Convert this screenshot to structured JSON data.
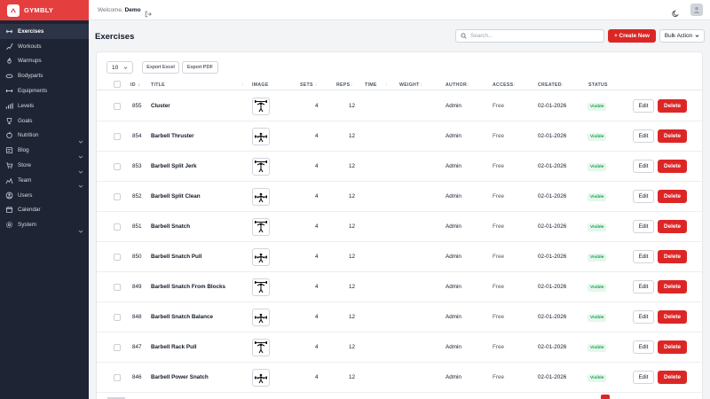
{
  "brand": {
    "name": "GYMBLY"
  },
  "topbar": {
    "welcome_prefix": "Welcome,",
    "user_name": "Demo"
  },
  "sidebar": {
    "items": [
      {
        "label": "Exercises",
        "icon": "dumbbell-icon",
        "active": true,
        "expandable": false
      },
      {
        "label": "Workouts",
        "icon": "workout-icon",
        "active": false,
        "expandable": false
      },
      {
        "label": "Warmups",
        "icon": "warmup-icon",
        "active": false,
        "expandable": false
      },
      {
        "label": "Bodyparts",
        "icon": "bodypart-icon",
        "active": false,
        "expandable": false
      },
      {
        "label": "Equipments",
        "icon": "equipment-icon",
        "active": false,
        "expandable": false
      },
      {
        "label": "Levels",
        "icon": "levels-icon",
        "active": false,
        "expandable": false
      },
      {
        "label": "Goals",
        "icon": "goals-icon",
        "active": false,
        "expandable": false
      },
      {
        "label": "Nutrition",
        "icon": "nutrition-icon",
        "active": false,
        "expandable": true
      },
      {
        "label": "Blog",
        "icon": "blog-icon",
        "active": false,
        "expandable": true
      },
      {
        "label": "Store",
        "icon": "store-icon",
        "active": false,
        "expandable": true
      },
      {
        "label": "Team",
        "icon": "team-icon",
        "active": false,
        "expandable": true
      },
      {
        "label": "Users",
        "icon": "users-icon",
        "active": false,
        "expandable": false
      },
      {
        "label": "Calendar",
        "icon": "calendar-icon",
        "active": false,
        "expandable": false
      },
      {
        "label": "System",
        "icon": "gear-icon",
        "active": false,
        "expandable": true
      }
    ]
  },
  "header": {
    "title": "Exercises",
    "search_placeholder": "Search...",
    "create_label": "+ Create New",
    "bulk_label": "Bulk Action"
  },
  "toolbar": {
    "page_size": "10",
    "export_excel": "Export Excel",
    "export_pdf": "Export PDF"
  },
  "table": {
    "columns": [
      "ID",
      "TITLE",
      "IMAGE",
      "SETS",
      "REPS",
      "TIME",
      "WEIGHT",
      "AUTHOR",
      "ACCESS",
      "CREATED",
      "STATUS"
    ],
    "edit_label": "Edit",
    "delete_label": "Delete",
    "rows": [
      {
        "id": "855",
        "title": "Cluster",
        "sets": "4",
        "reps": "12",
        "author": "Admin",
        "access": "Free",
        "created": "02-01-2026",
        "status": "Visible"
      },
      {
        "id": "854",
        "title": "Barbell Thruster",
        "sets": "4",
        "reps": "12",
        "author": "Admin",
        "access": "Free",
        "created": "02-01-2026",
        "status": "Visible"
      },
      {
        "id": "853",
        "title": "Barbell Split Jerk",
        "sets": "4",
        "reps": "12",
        "author": "Admin",
        "access": "Free",
        "created": "02-01-2026",
        "status": "Visible"
      },
      {
        "id": "852",
        "title": "Barbell Split Clean",
        "sets": "4",
        "reps": "12",
        "author": "Admin",
        "access": "Free",
        "created": "02-01-2026",
        "status": "Visible"
      },
      {
        "id": "851",
        "title": "Barbell Snatch",
        "sets": "4",
        "reps": "12",
        "author": "Admin",
        "access": "Free",
        "created": "02-01-2026",
        "status": "Visible"
      },
      {
        "id": "850",
        "title": "Barbell Snatch Pull",
        "sets": "4",
        "reps": "12",
        "author": "Admin",
        "access": "Free",
        "created": "02-01-2026",
        "status": "Visible"
      },
      {
        "id": "849",
        "title": "Barbell Snatch From Blocks",
        "sets": "4",
        "reps": "12",
        "author": "Admin",
        "access": "Free",
        "created": "02-01-2026",
        "status": "Visible"
      },
      {
        "id": "848",
        "title": "Barbell Snatch Balance",
        "sets": "4",
        "reps": "12",
        "author": "Admin",
        "access": "Free",
        "created": "02-01-2026",
        "status": "Visible"
      },
      {
        "id": "847",
        "title": "Barbell Rack Pull",
        "sets": "4",
        "reps": "12",
        "author": "Admin",
        "access": "Free",
        "created": "02-01-2026",
        "status": "Visible"
      },
      {
        "id": "846",
        "title": "Barbell Power Snatch",
        "sets": "4",
        "reps": "12",
        "author": "Admin",
        "access": "Free",
        "created": "02-01-2026",
        "status": "Visible"
      }
    ]
  },
  "colors": {
    "brand": "#e53e3e",
    "sidebar": "#1e2433",
    "danger": "#dc2626",
    "success": "#16a34a"
  }
}
